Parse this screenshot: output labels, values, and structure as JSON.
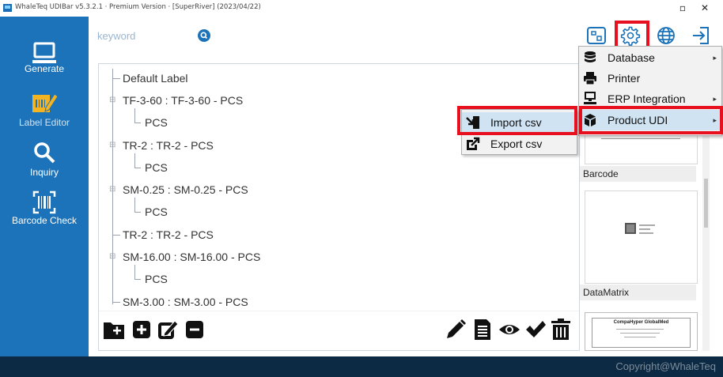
{
  "window": {
    "title": "WhaleTeq UDIBar v5.3.2.1 · Premium Version · [SuperRiver] (2023/04/22)",
    "minimize_glyph": "▫",
    "close_glyph": "✕"
  },
  "sidebar": {
    "items": [
      {
        "label": "Generate",
        "icon": "monitor-icon"
      },
      {
        "label": "Label Editor",
        "icon": "label-edit-icon",
        "active": true
      },
      {
        "label": "Inquiry",
        "icon": "magnifier-icon"
      },
      {
        "label": "Barcode Check",
        "icon": "barcode-scan-icon"
      }
    ]
  },
  "search": {
    "placeholder": "keyword",
    "icon": "search-icon"
  },
  "top_icons": [
    "scan-frame-icon",
    "gear-icon",
    "globe-icon",
    "logout-icon"
  ],
  "tree": {
    "rows": [
      "Default Label",
      "TF-3-60 : TF-3-60 - PCS",
      "PCS",
      "TR-2 : TR-2 - PCS",
      "PCS",
      "SM-0.25 : SM-0.25 - PCS",
      "PCS",
      "TR-2 : TR-2 - PCS",
      "SM-16.00 : SM-16.00 - PCS",
      "PCS",
      "SM-3.00 : SM-3.00 - PCS"
    ]
  },
  "toolbar": {
    "left": [
      "add-folder-icon",
      "add-item-icon",
      "edit-item-icon",
      "remove-item-icon"
    ],
    "right": [
      "pencil-icon",
      "document-list-icon",
      "eye-icon",
      "checkmark-icon",
      "trash-icon"
    ]
  },
  "preview": {
    "cards": [
      {
        "label": "Barcode"
      },
      {
        "label": "DataMatrix"
      },
      {
        "label": ""
      }
    ],
    "sample_title": "CompaHyper GlobalMed"
  },
  "settings_menu": {
    "items": [
      {
        "label": "Database",
        "icon": "database-icon",
        "has_submenu": true
      },
      {
        "label": "Printer",
        "icon": "printer-icon",
        "has_submenu": false
      },
      {
        "label": "ERP Integration",
        "icon": "network-icon",
        "has_submenu": true
      },
      {
        "label": "Product UDI",
        "icon": "box-icon",
        "has_submenu": true,
        "selected": true
      }
    ],
    "submenu_arrow": "▸"
  },
  "udi_submenu": {
    "items": [
      {
        "label": "Import csv",
        "icon": "import-icon",
        "selected": true
      },
      {
        "label": "Export csv",
        "icon": "export-icon",
        "selected": false
      }
    ]
  },
  "footer": {
    "copyright": "Copyright@WhaleTeq"
  },
  "colors": {
    "sidebar": "#1c73b9",
    "footer": "#0d2a45",
    "highlight": "#e8101f",
    "menu_selected": "#cfe3f3"
  }
}
